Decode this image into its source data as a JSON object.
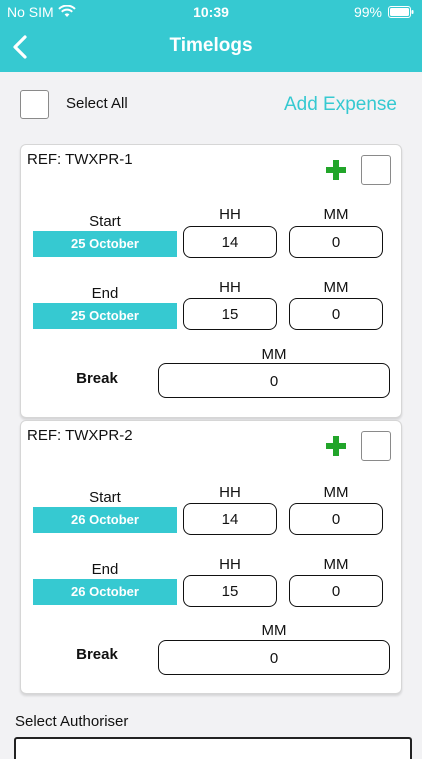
{
  "status_bar": {
    "carrier": "No SIM",
    "time": "10:39",
    "battery": "99%"
  },
  "header": {
    "title": "Timelogs"
  },
  "toolbar": {
    "select_all_label": "Select All",
    "add_expense_label": "Add Expense"
  },
  "labels": {
    "start": "Start",
    "end": "End",
    "break": "Break",
    "hh": "HH",
    "mm": "MM"
  },
  "timelogs": [
    {
      "ref": "REF: TWXPR-1",
      "start": {
        "date": "25 October",
        "hh": "14",
        "mm": "0"
      },
      "end": {
        "date": "25 October",
        "hh": "15",
        "mm": "0"
      },
      "break_mm": "0"
    },
    {
      "ref": "REF: TWXPR-2",
      "start": {
        "date": "26 October",
        "hh": "14",
        "mm": "0"
      },
      "end": {
        "date": "26 October",
        "hh": "15",
        "mm": "0"
      },
      "break_mm": "0"
    }
  ],
  "authoriser": {
    "label": "Select Authoriser"
  },
  "colors": {
    "accent": "#36c9d1",
    "plus": "#22a52a",
    "background": "#f2f2f4"
  }
}
